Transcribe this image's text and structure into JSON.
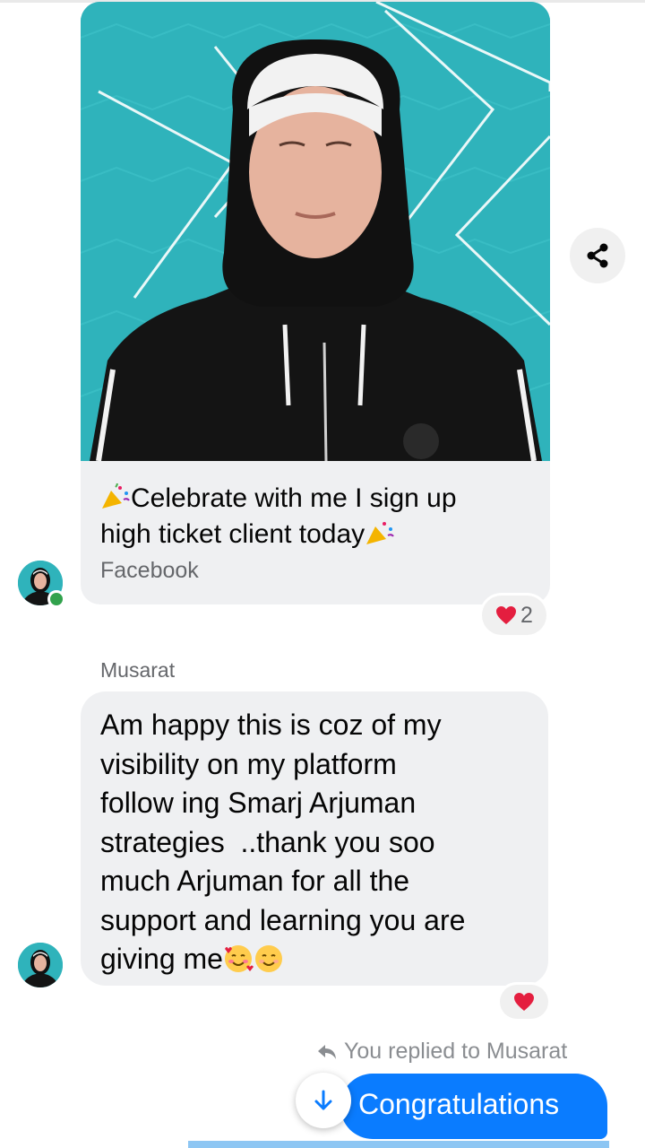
{
  "post": {
    "caption_part1": "Celebrate with me I sign up",
    "caption_part2": "high ticket client today",
    "source": "Facebook",
    "reaction_count": "2",
    "emoji_left": "party-popper",
    "emoji_right": "party-popper"
  },
  "message": {
    "sender": "Musarat",
    "text": "Am happy this is coz of my\nvisibility on my platform\nfollow ing Smarj Arjuman\nstrategies  ..thank you soo\nmuch Arjuman for all the\nsupport and learning you are\ngiving me",
    "emojis": [
      "smiling-face-with-hearts",
      "smiling-face"
    ],
    "reaction": "heart"
  },
  "reply": {
    "context": "You replied to Musarat",
    "text": "Congratulations"
  },
  "icons": {
    "share": "share-icon",
    "reply_arrow": "reply-arrow-icon",
    "scroll_down": "arrow-down-icon"
  },
  "colors": {
    "accent": "#0a7cff",
    "bubble": "#eff0f2",
    "media_bg": "#2fb3bb",
    "heart": "#e41e3f",
    "online": "#31a24c"
  }
}
